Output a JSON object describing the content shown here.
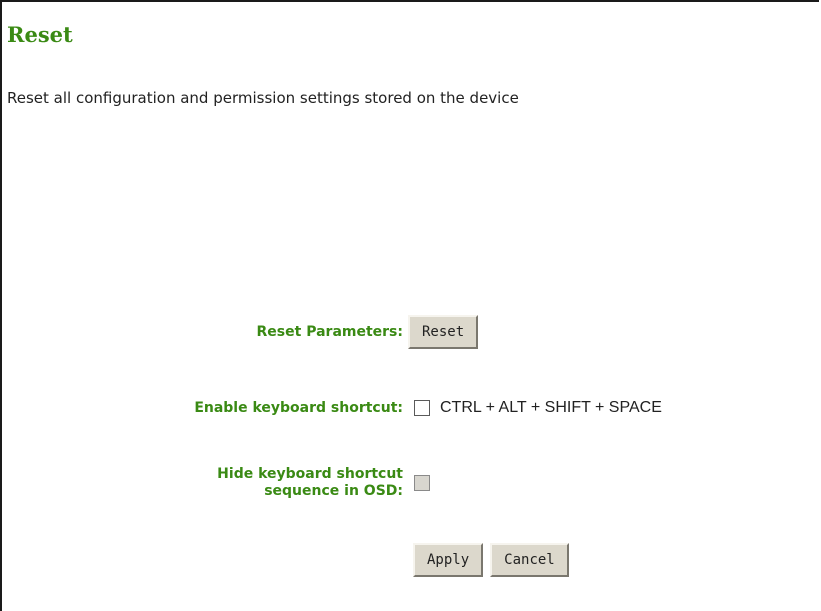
{
  "page": {
    "title": "Reset",
    "description": "Reset all configuration and permission settings stored on the device"
  },
  "reset_parameters": {
    "label": "Reset Parameters:",
    "button_label": "Reset"
  },
  "keyboard_shortcut": {
    "label": "Enable keyboard shortcut:",
    "checked": false,
    "sequence": "CTRL + ALT + SHIFT + SPACE"
  },
  "hide_shortcut": {
    "label_line1": "Hide keyboard shortcut",
    "label_line2": "sequence in OSD:",
    "checked": false,
    "disabled": true
  },
  "actions": {
    "apply_label": "Apply",
    "cancel_label": "Cancel"
  },
  "colors": {
    "accent_green": "#3a8a14",
    "button_face": "#dcd8cc"
  }
}
